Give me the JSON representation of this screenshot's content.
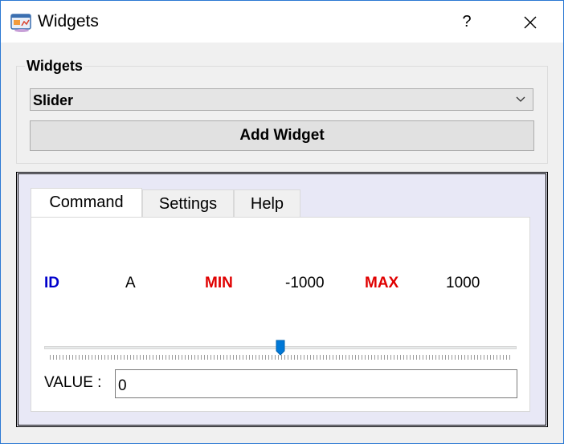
{
  "window": {
    "title": "Widgets",
    "help_glyph": "?",
    "accent_color": "#2b78d3"
  },
  "group": {
    "label": "Widgets",
    "combo_value": "Slider",
    "add_button": "Add Widget"
  },
  "tabs": [
    {
      "label": "Command",
      "active": true
    },
    {
      "label": "Settings",
      "active": false
    },
    {
      "label": "Help",
      "active": false
    }
  ],
  "command": {
    "id_label": "ID",
    "id_value": "A",
    "min_label": "MIN",
    "min_value": "-1000",
    "max_label": "MAX",
    "max_value": "1000",
    "value_label": "VALUE :",
    "value_input": "0",
    "slider_fraction": 0.5
  },
  "colors": {
    "id_blue": "#0000cc",
    "minmax_red": "#e00000",
    "handle_blue": "#0078d7"
  }
}
